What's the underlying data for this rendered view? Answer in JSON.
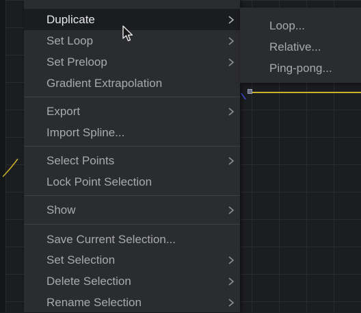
{
  "context_menu": {
    "items": [
      {
        "label": "Duplicate",
        "has_submenu": true,
        "highlighted": true
      },
      {
        "label": "Set Loop",
        "has_submenu": true
      },
      {
        "label": "Set Preloop",
        "has_submenu": true
      },
      {
        "label": "Gradient Extrapolation",
        "has_submenu": false
      },
      {
        "label": "Export",
        "has_submenu": true
      },
      {
        "label": "Import Spline...",
        "has_submenu": false
      },
      {
        "label": "Select Points",
        "has_submenu": true
      },
      {
        "label": "Lock Point Selection",
        "has_submenu": false
      },
      {
        "label": "Show",
        "has_submenu": true
      },
      {
        "label": "Save Current Selection...",
        "has_submenu": false
      },
      {
        "label": "Set Selection",
        "has_submenu": true
      },
      {
        "label": "Delete Selection",
        "has_submenu": true
      },
      {
        "label": "Rename Selection",
        "has_submenu": true
      }
    ]
  },
  "submenu": {
    "items": [
      {
        "label": "Loop..."
      },
      {
        "label": "Relative..."
      },
      {
        "label": "Ping-pong..."
      }
    ]
  },
  "colors": {
    "menu_background": "#2b2c30",
    "highlight_background": "#1b1c1f",
    "text": "#a8aaad",
    "highlight_text": "#e8e9eb",
    "spline": "#c9b32a"
  },
  "icons": {
    "chevron": "chevron-right-icon",
    "cursor": "mouse-pointer-icon"
  }
}
